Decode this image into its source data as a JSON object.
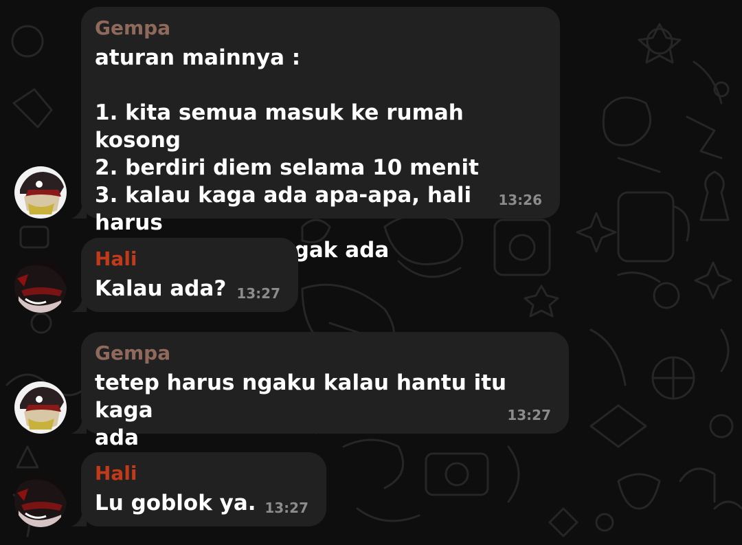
{
  "colors": {
    "background": "#0e0e0e",
    "bubble": "#212121",
    "gempa_name": "#8f6a5c",
    "hali_name": "#c23a1a",
    "message_text": "#ffffff",
    "timestamp": "#8c8c8c"
  },
  "messages": [
    {
      "sender": "Gempa",
      "text": "aturan mainnya :\n\n1. kita semua masuk ke rumah kosong\n2. berdiri diem selama 10 menit\n3. kalau kaga ada apa-apa, hali harus\nngaku hantu itu gak ada",
      "time": "13:26"
    },
    {
      "sender": "Hali",
      "text": "Kalau ada?",
      "time": "13:27"
    },
    {
      "sender": "Gempa",
      "text": "tetep harus ngaku kalau hantu itu kaga\nada",
      "time": "13:27"
    },
    {
      "sender": "Hali",
      "text": "Lu goblok ya.",
      "time": "13:27"
    }
  ]
}
